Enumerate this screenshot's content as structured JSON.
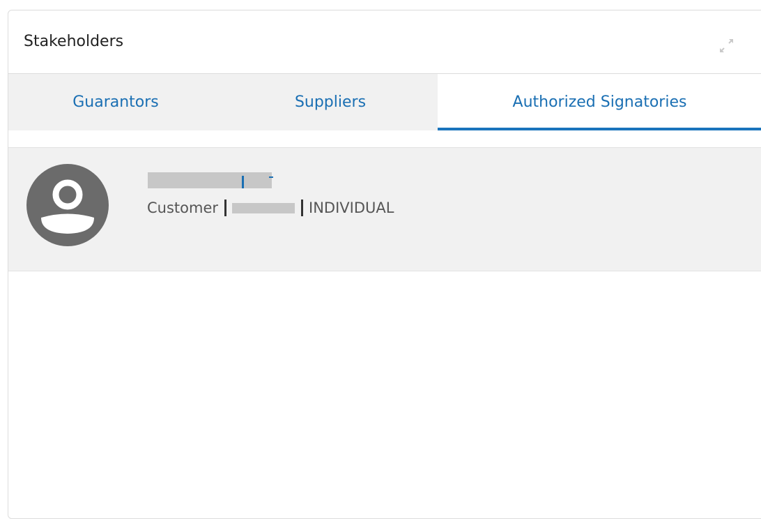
{
  "panel": {
    "title": "Stakeholders",
    "expand_icon": "expand-icon"
  },
  "tabs": [
    {
      "label": "Guarantors",
      "active": false
    },
    {
      "label": "Suppliers",
      "active": false
    },
    {
      "label": "Authorized Signatories",
      "active": true
    }
  ],
  "colors": {
    "accent": "#1a74bc",
    "link": "#1a6fb3",
    "tab_bg": "#f1f1f1",
    "avatar": "#6b6b6b",
    "redaction": "#c7c7c7"
  },
  "signatory": {
    "avatar_icon": "user-avatar-icon",
    "role": "Customer",
    "type": "INDIVIDUAL"
  }
}
